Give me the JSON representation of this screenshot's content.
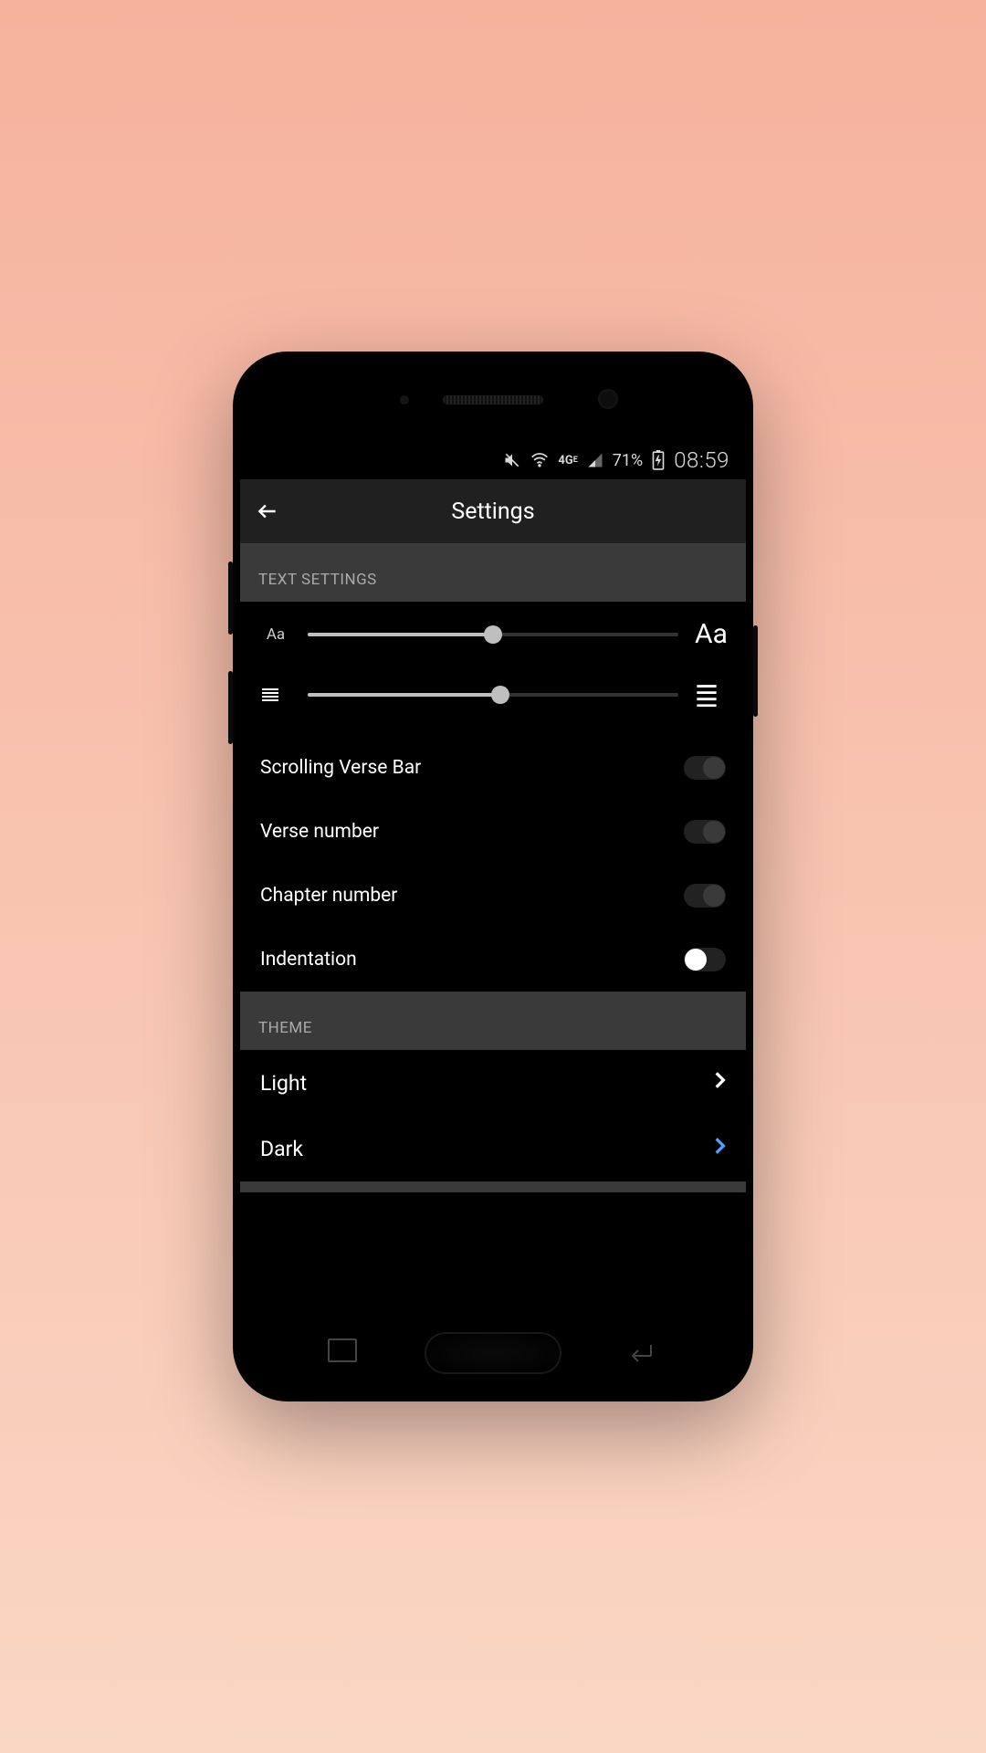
{
  "status": {
    "battery_pct": "71%",
    "clock": "08:59"
  },
  "appbar": {
    "title": "Settings"
  },
  "sections": {
    "text": {
      "header": "TEXT SETTINGS",
      "font_small_label": "Aa",
      "font_big_label": "Aa",
      "toggles": {
        "scroll_bar": "Scrolling Verse Bar",
        "verse_num": "Verse number",
        "chapter_num": "Chapter number",
        "indentation": "Indentation"
      }
    },
    "theme": {
      "header": "THEME",
      "light": "Light",
      "dark": "Dark"
    }
  },
  "colors": {
    "accent": "#4aa3ff"
  }
}
